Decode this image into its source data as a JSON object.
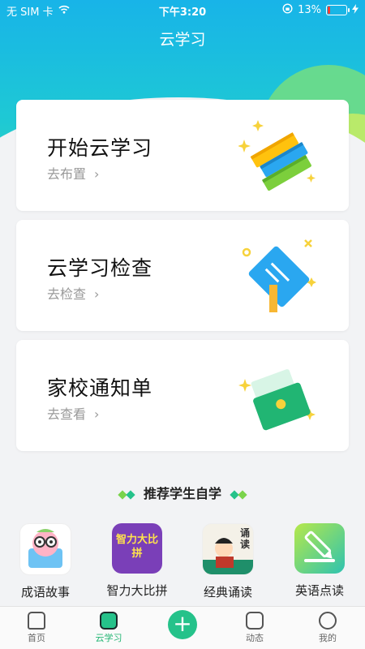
{
  "status": {
    "carrier": "无 SIM 卡",
    "time": "下午3:20",
    "battery": "13%"
  },
  "header": {
    "title": "云学习"
  },
  "cards": [
    {
      "title": "开始云学习",
      "subtitle": "去布置"
    },
    {
      "title": "云学习检查",
      "subtitle": "去检查"
    },
    {
      "title": "家校通知单",
      "subtitle": "去查看"
    }
  ],
  "recommend": {
    "title": "推荐学生自学",
    "apps": [
      {
        "name": "成语故事",
        "icon": "idiom-story-icon"
      },
      {
        "name": "智力大比拼",
        "icon": "brain-contest-icon",
        "icon_text": "智力大比拼"
      },
      {
        "name": "经典诵读",
        "icon": "classic-reading-icon",
        "icon_text": "诵读"
      },
      {
        "name": "英语点读",
        "icon": "english-reading-icon"
      }
    ]
  },
  "tabbar": [
    {
      "label": "首页",
      "icon": "home-icon"
    },
    {
      "label": "云学习",
      "icon": "cloud-study-icon",
      "active": true
    },
    {
      "label": "",
      "icon": "plus-icon"
    },
    {
      "label": "动态",
      "icon": "feed-icon"
    },
    {
      "label": "我的",
      "icon": "profile-icon"
    }
  ],
  "colors": {
    "accent": "#21b573",
    "hero": "#18b4e8"
  }
}
